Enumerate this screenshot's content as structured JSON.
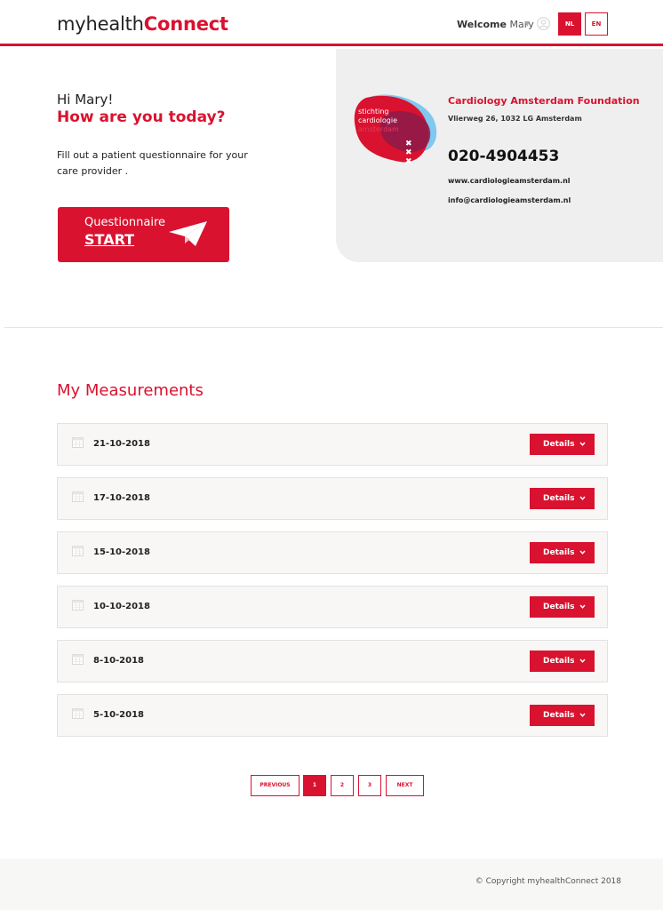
{
  "header": {
    "logo_part1": "myhealth",
    "logo_part2": "Connect",
    "welcome_prefix": "Welcome",
    "welcome_name": "Mary",
    "lang_nl": "NL",
    "lang_en": "EN"
  },
  "hero": {
    "greeting": "Hi Mary!",
    "question": "How are you today?",
    "intro": "Fill out a patient questionnaire for your care provider .",
    "questionnaire_label": "Questionnaire",
    "start_label": "START"
  },
  "provider": {
    "logo_text_1": "stichting",
    "logo_text_2": "cardiologie",
    "logo_text_3": "amsterdam",
    "name": "Cardiology Amsterdam Foundation",
    "address": "Vlierweg 26, 1032 LG Amsterdam",
    "phone": "020-4904453",
    "website": "www.cardiologieamsterdam.nl",
    "email": "info@cardiologieamsterdam.nl"
  },
  "measurements": {
    "title": "My Measurements",
    "details_label": "Details",
    "rows": [
      {
        "date": "21-10-2018"
      },
      {
        "date": "17-10-2018"
      },
      {
        "date": "15-10-2018"
      },
      {
        "date": "10-10-2018"
      },
      {
        "date": "8-10-2018"
      },
      {
        "date": "5-10-2018"
      }
    ]
  },
  "pagination": {
    "previous": "PREVIOUS",
    "pages": [
      "1",
      "2",
      "3"
    ],
    "next": "NEXT",
    "current": "1"
  },
  "footer": {
    "copyright": "© Copyright myhealthConnect 2018"
  },
  "colors": {
    "brand": "#d9122f",
    "panel": "#efefef"
  }
}
